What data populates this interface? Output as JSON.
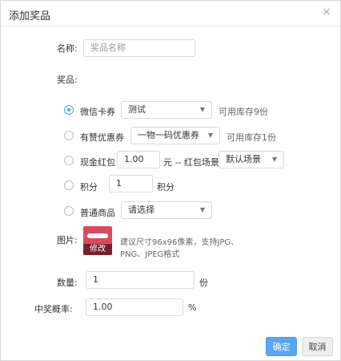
{
  "dialog": {
    "title": "添加奖品",
    "close": "×"
  },
  "name": {
    "label": "名称:",
    "placeholder": "奖品名称"
  },
  "prize": {
    "label": "奖品:",
    "options": [
      {
        "label": "微信卡券",
        "selected": true,
        "select": "测试",
        "note": "可用库存9份"
      },
      {
        "label": "有赞优惠券",
        "selected": false,
        "select": "一物一码优惠券",
        "note": "可用库存1份"
      },
      {
        "label": "现金红包",
        "selected": false,
        "amount": "1.00",
        "unit": "元 -- 红包场景",
        "select": "默认场景"
      },
      {
        "label": "积分",
        "selected": false,
        "amount": "1",
        "unit": "积分"
      },
      {
        "label": "普通商品",
        "selected": false,
        "select": "请选择"
      }
    ]
  },
  "image": {
    "label": "图片:",
    "edit": "修改",
    "hint_line1": "建议尺寸96x96像素，支持JPG、",
    "hint_line2": "PNG、JPEG格式"
  },
  "quantity": {
    "label": "数量:",
    "value": "1",
    "unit": "份"
  },
  "probability": {
    "label": "中奖概率:",
    "value": "1.00",
    "unit": "%"
  },
  "buttons": {
    "ok": "确定",
    "cancel": "取消"
  }
}
